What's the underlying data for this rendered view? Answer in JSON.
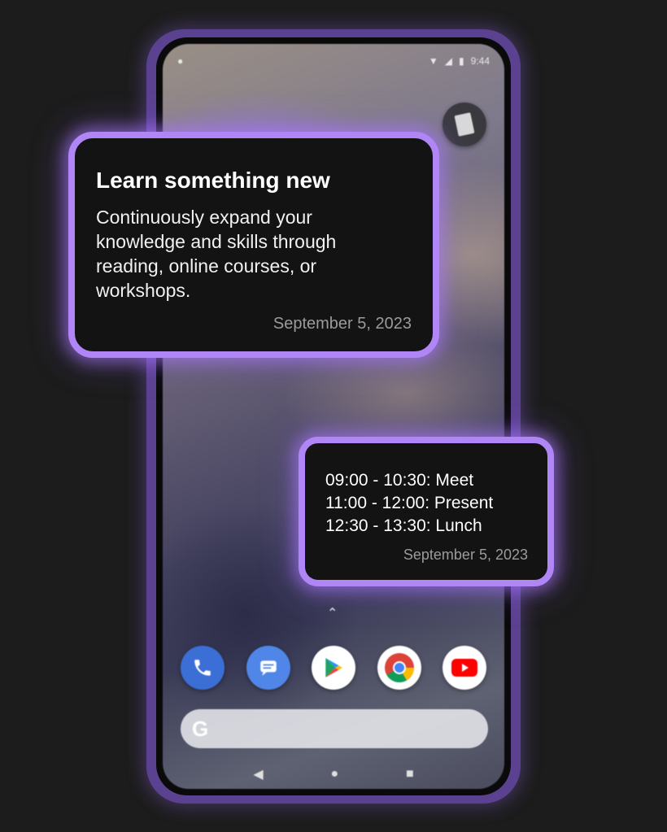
{
  "status_bar": {
    "time": "9:44"
  },
  "widgets": {
    "note": {
      "title": "Learn something new",
      "body": "Continuously expand your knowledge and skills through reading, online courses, or workshops.",
      "date": "September 5, 2023"
    },
    "schedule": {
      "items": [
        "09:00 - 10:30: Meet",
        "11:00 - 12:00: Present",
        "12:30 - 13:30: Lunch"
      ],
      "date": "September 5, 2023"
    }
  },
  "colors": {
    "accent": "#b085f5",
    "widget_bg": "#131313",
    "date_text": "#9b9b9b"
  },
  "dock_apps": [
    "phone-icon",
    "messages-icon",
    "play-store-icon",
    "chrome-icon",
    "youtube-icon"
  ],
  "search": {
    "logo": "G"
  },
  "nav": [
    "back-icon",
    "home-icon",
    "recents-icon"
  ]
}
